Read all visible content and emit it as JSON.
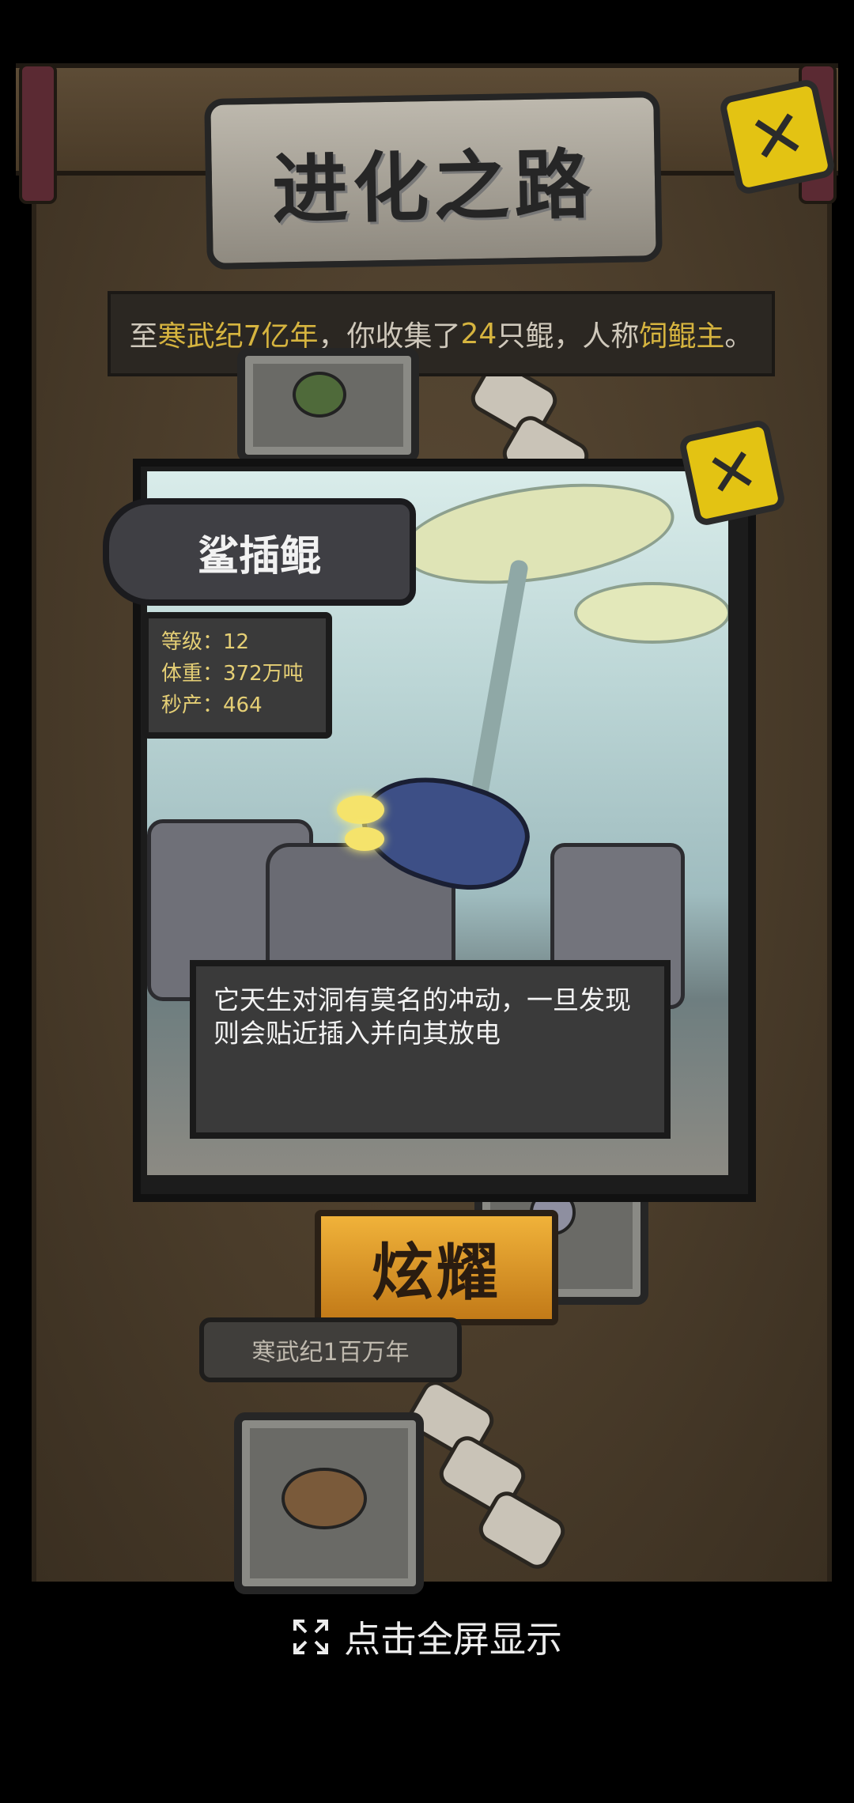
{
  "title": "进化之路",
  "summary": {
    "prefix": "至",
    "era": "寒武纪7亿年",
    "mid": "，你收集了",
    "count": "24",
    "mid2": "只鲲，人称",
    "honor": "饲鲲主",
    "suffix": "。"
  },
  "creature": {
    "name": "鲨插鲲",
    "stats": [
      {
        "label": "等级：",
        "value": "12"
      },
      {
        "label": "体重：",
        "value": "372万吨"
      },
      {
        "label": "秒产：",
        "value": "464"
      }
    ],
    "description": "它天生对洞有莫名的冲动，一旦发现则会贴近插入并向其放电"
  },
  "show_button": "炫耀",
  "era_label": "寒武纪1百万年",
  "fullscreen_hint": "点击全屏显示",
  "icons": {
    "close": "close-icon",
    "expand": "expand-icon"
  },
  "colors": {
    "highlight": "#d6b43f",
    "close_button": "#e3c313",
    "show_button": "#f0b23a"
  }
}
